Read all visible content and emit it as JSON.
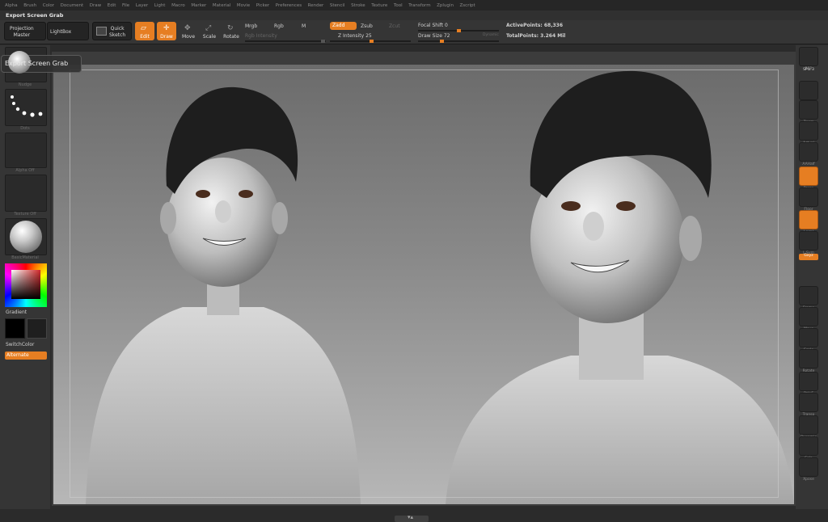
{
  "menu": [
    "Alpha",
    "Brush",
    "Color",
    "Document",
    "Draw",
    "Edit",
    "File",
    "Layer",
    "Light",
    "Macro",
    "Marker",
    "Material",
    "Movie",
    "Picker",
    "Preferences",
    "Render",
    "Stencil",
    "Stroke",
    "Texture",
    "Tool",
    "Transform",
    "Zplugin",
    "Zscript"
  ],
  "title": "Export Screen Grab",
  "toolbar": {
    "projection_master": "Projection\nMaster",
    "lightbox": "LightBox",
    "quick_sketch": "Quick\nSketch",
    "edit": "Edit",
    "draw": "Draw",
    "move": "Move",
    "scale": "Scale",
    "rotate": "Rotate",
    "mrgb": "Mrgb",
    "rgb": "Rgb",
    "m": "M",
    "rgb_intensity": "Rgb Intensity",
    "zadd": "Zadd",
    "zsub": "Zsub",
    "zcut": "Zcut",
    "z_intensity_label": "Z Intensity",
    "z_intensity_value": "25",
    "focal_shift_label": "Focal Shift",
    "focal_shift_value": "0",
    "draw_size_label": "Draw Size",
    "draw_size_value": "72",
    "dynamic": "Dynamic",
    "active_points": "ActivePoints: 68,336",
    "total_points": "TotalPoints: 3.264 Mil"
  },
  "tooltip": "Export Screen Grab",
  "left_shelf": {
    "brush_label": "Nudge",
    "stroke_label": "Dots",
    "alpha_label": "Alpha Off",
    "texture_label": "Texture Off",
    "material_label": "BasicMaterial",
    "gradient": "Gradient",
    "switch_color": "SwitchColor",
    "alternate": "Alternate"
  },
  "right_shelf": {
    "bpr": "BPR",
    "spix": "SPix 3",
    "scroll": "Scroll",
    "zoom": "Zoom",
    "actual": "Actual",
    "aahalf": "AAHalf",
    "persp": "Persp",
    "floor": "Floor",
    "local": "Local",
    "lsym": "L.Sym",
    "xyz": "Gxyz",
    "frame": "Frame",
    "move": "Move",
    "scale": "Scale",
    "rotate": "Rotate",
    "polyf": "PolyF",
    "transp": "Transp",
    "dynamic": "Dynamic",
    "solo": "Solo",
    "xpose": "Xpose"
  },
  "colors": {
    "accent": "#e67e22",
    "panel": "#353535",
    "menubar": "#262626"
  }
}
